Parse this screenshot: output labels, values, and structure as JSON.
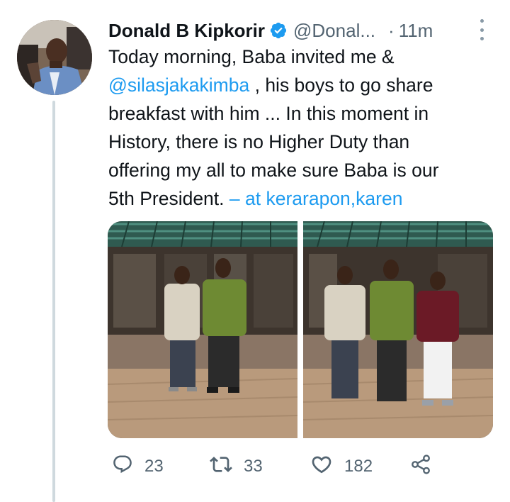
{
  "tweet": {
    "author_name": "Donald B Kipkorir",
    "handle": "@Donal...",
    "separator": "·",
    "time": "11m",
    "verified_icon": "verified-badge-icon",
    "text_lines": [
      "Today morning, Baba invited me &",
      "@silasjakakimba",
      ", his boys to go share",
      "breakfast with him ... In this moment in",
      "History, there is no Higher Duty than",
      "offering my all to make sure Baba is our",
      "5th President.",
      "– at kerarapon,karen"
    ],
    "accent_color": "#1d9bf0"
  },
  "actions": {
    "reply_count": "23",
    "retweet_count": "33",
    "like_count": "182",
    "icons": [
      "reply-icon",
      "retweet-icon",
      "like-icon",
      "share-icon"
    ]
  }
}
